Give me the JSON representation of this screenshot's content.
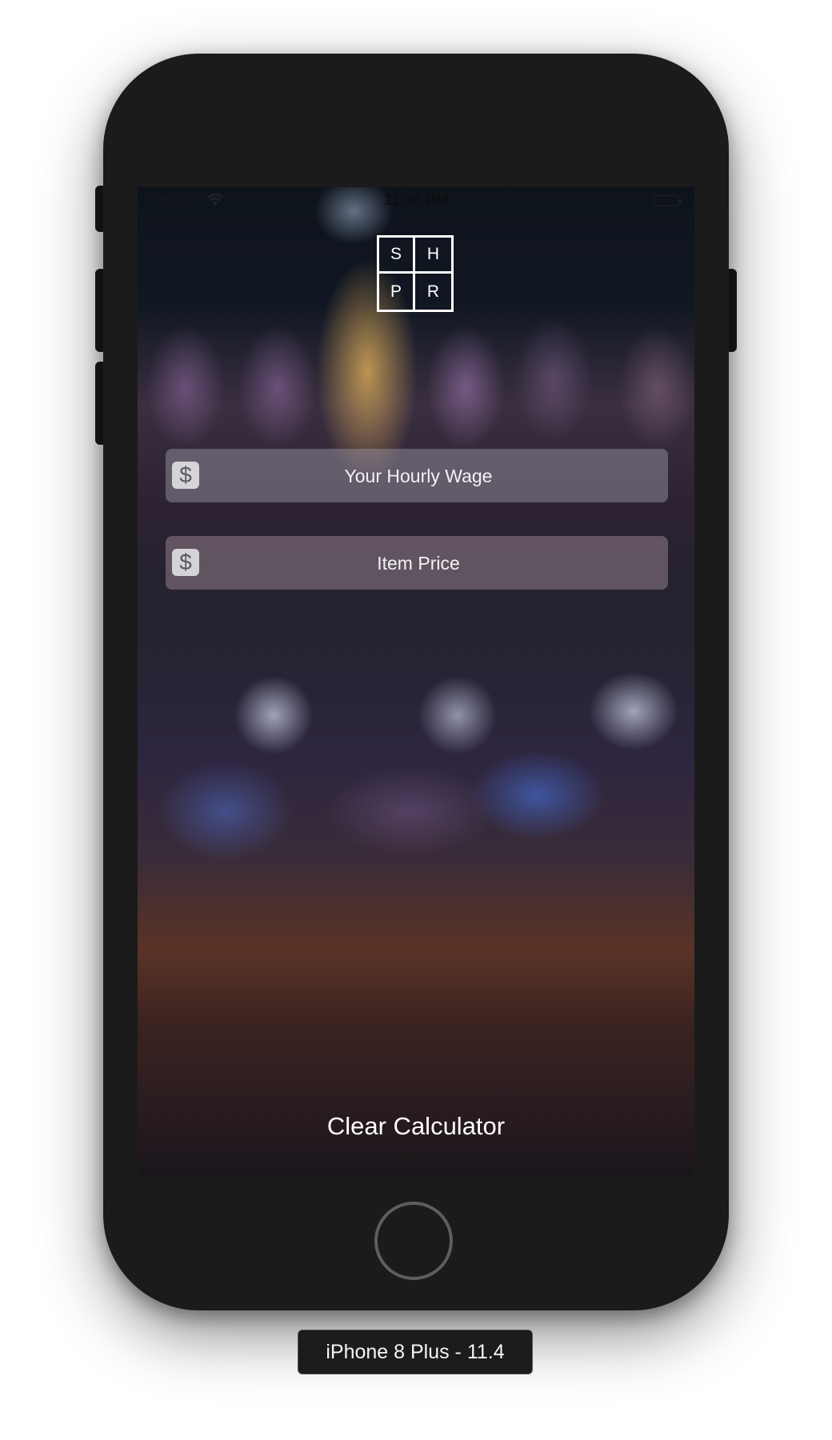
{
  "status_bar": {
    "carrier": "Carrier",
    "time": "11:26 PM",
    "wifi_icon": "wifi-icon",
    "battery_icon": "battery-icon"
  },
  "logo": {
    "letters": [
      "S",
      "H",
      "P",
      "R"
    ]
  },
  "fields": {
    "wage": {
      "icon": "dollar-icon",
      "icon_glyph": "$",
      "placeholder": "Your Hourly Wage",
      "value": ""
    },
    "price": {
      "icon": "dollar-icon",
      "icon_glyph": "$",
      "placeholder": "Item Price",
      "value": ""
    }
  },
  "actions": {
    "clear_label": "Clear Calculator"
  },
  "device": {
    "label": "iPhone 8 Plus - 11.4"
  },
  "colors": {
    "phone_body": "#1b1b1b",
    "text": "#ffffff"
  }
}
